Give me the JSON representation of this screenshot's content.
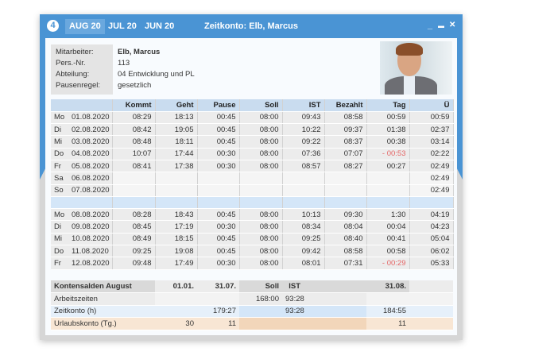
{
  "window": {
    "title": "Zeitkonto: Elb, Marcus",
    "logo": "4",
    "tabs": [
      {
        "label": "AUG 20",
        "active": true
      },
      {
        "label": "JUL 20"
      },
      {
        "label": "JUN 20"
      }
    ],
    "controls": {
      "minimize": "_",
      "maximize": "▬",
      "close": "✕"
    }
  },
  "employee": {
    "labels": [
      "Mitarbeiter:",
      "Pers.-Nr.",
      "Abteilung:",
      "Pausenregel:"
    ],
    "values": [
      "Elb, Marcus",
      "113",
      "04 Entwicklung und PL",
      "gesetzlich"
    ]
  },
  "table": {
    "headers": [
      "",
      "",
      "Kommt",
      "Geht",
      "Pause",
      "Soll",
      "IST",
      "Bezahlt",
      "Tag",
      "Ü"
    ],
    "week1": [
      [
        "Mo",
        "01.08.2020",
        "08:29",
        "18:13",
        "00:45",
        "08:00",
        "09:43",
        "08:58",
        "00:59",
        "00:59"
      ],
      [
        "Di",
        "02.08.2020",
        "08:42",
        "19:05",
        "00:45",
        "08:00",
        "10:22",
        "09:37",
        "01:38",
        "02:37"
      ],
      [
        "Mi",
        "03.08.2020",
        "08:48",
        "18:11",
        "00:45",
        "08:00",
        "09:22",
        "08:37",
        "00:38",
        "03:14"
      ],
      [
        "Do",
        "04.08.2020",
        "10:07",
        "17:44",
        "00:30",
        "08:00",
        "07:36",
        "07:07",
        "- 00:53",
        "02:22"
      ],
      [
        "Fr",
        "05.08.2020",
        "08:41",
        "17:38",
        "00:30",
        "08:00",
        "08:57",
        "08:27",
        "00:27",
        "02:49"
      ],
      [
        "Sa",
        "06.08.2020",
        "",
        "",
        "",
        "",
        "",
        "",
        "",
        "02:49"
      ],
      [
        "So",
        "07.08.2020",
        "",
        "",
        "",
        "",
        "",
        "",
        "",
        "02:49"
      ]
    ],
    "week2": [
      [
        "Mo",
        "08.08.2020",
        "08:28",
        "18:43",
        "00:45",
        "08:00",
        "10:13",
        "09:30",
        "1:30",
        "04:19"
      ],
      [
        "Di",
        "09.08.2020",
        "08:45",
        "17:19",
        "00:30",
        "08:00",
        "08:34",
        "08:04",
        "00:04",
        "04:23"
      ],
      [
        "Mi",
        "10.08.2020",
        "08:49",
        "18:15",
        "00:45",
        "08:00",
        "09:25",
        "08:40",
        "00:41",
        "05:04"
      ],
      [
        "Do",
        "11.08.2020",
        "09:25",
        "19:08",
        "00:45",
        "08:00",
        "09:42",
        "08:58",
        "00:58",
        "06:02"
      ],
      [
        "Fr",
        "12.08.2020",
        "09:48",
        "17:49",
        "00:30",
        "08:00",
        "08:01",
        "07:31",
        "- 00:29",
        "05:33"
      ]
    ]
  },
  "summary": {
    "headers": [
      "Kontensalden August",
      "01.01.",
      "31.07.",
      "Soll",
      "IST",
      "",
      "31.08.",
      ""
    ],
    "rows": [
      [
        "Arbeitszeiten",
        "",
        "",
        "168:00",
        "93:28",
        "",
        "",
        ""
      ],
      [
        "Zeitkonto (h)",
        "",
        "179:27",
        "",
        "93:28",
        "",
        "184:55",
        ""
      ],
      [
        "Urlaubskonto (Tg.)",
        "30",
        "11",
        "",
        "",
        "",
        "11",
        ""
      ]
    ]
  },
  "colors": {
    "accent": "#4a94d4",
    "negative": "#e56666"
  }
}
